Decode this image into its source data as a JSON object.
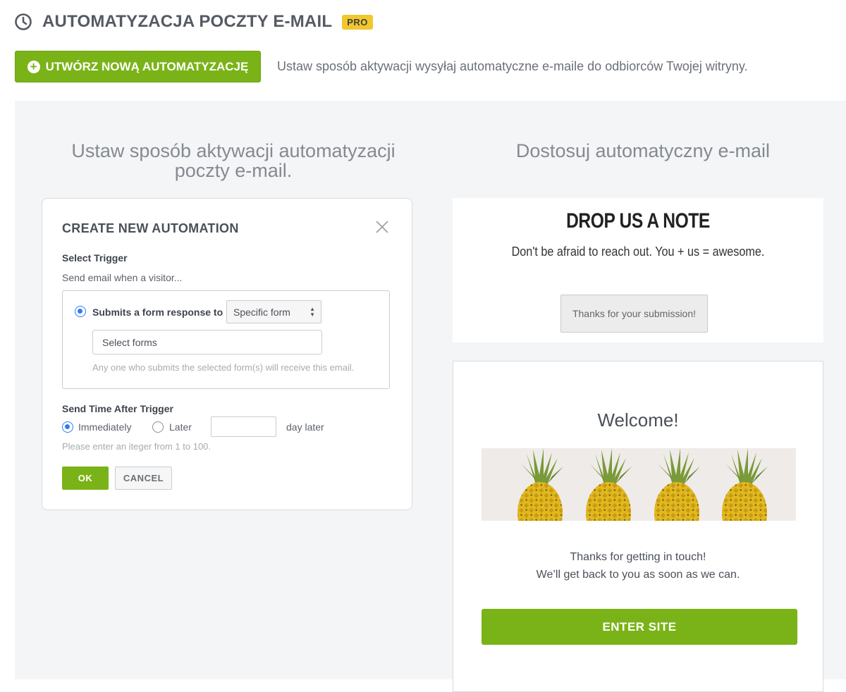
{
  "header": {
    "title": "AUTOMATYZACJA POCZTY E-MAIL",
    "badge": "PRO",
    "clock_icon": "clock-icon"
  },
  "toolbar": {
    "create_label": "UTWÓRZ NOWĄ AUTOMATYZACJĘ",
    "create_icon": "plus-circle-icon",
    "intro": "Ustaw sposób aktywacji wysyłaj automatyczne e-maile do odbiorców Twojej witryny."
  },
  "left": {
    "heading_line1": "Ustaw sposób aktywacji automatyzacji",
    "heading_line2": "poczty e-mail."
  },
  "right": {
    "heading": "Dostosuj automatyczny e-mail"
  },
  "automation": {
    "title": "CREATE NEW AUTOMATION",
    "select_trigger_label": "Select Trigger",
    "send_when": "Send email when a visitor...",
    "trigger_option": "Submits a form response to",
    "form_select_value": "Specific form",
    "forms_input_placeholder": "Select forms",
    "trigger_hint": "Any one who submits the selected form(s) will receive this email.",
    "send_time_label": "Send Time After Trigger",
    "immediately_label": "Immediately",
    "later_label": "Later",
    "days_suffix": "day later",
    "integer_hint": "Please enter an iteger  from 1 to 100.",
    "ok_label": "OK",
    "cancel_label": "CANCEL"
  },
  "note_preview": {
    "title": "DROP US A NOTE",
    "subtitle": "Don't be afraid to reach out. You + us = awesome.",
    "button_label": "Thanks for your submission!"
  },
  "email_preview": {
    "welcome": "Welcome!",
    "thanks_line1": "Thanks for getting in touch!",
    "thanks_line2": "We’ll get back to you as soon as we can.",
    "enter_label": "ENTER SITE"
  },
  "colors": {
    "accent_green": "#7ab317",
    "badge_yellow": "#f2c72e",
    "radio_blue": "#2f7cf6"
  }
}
